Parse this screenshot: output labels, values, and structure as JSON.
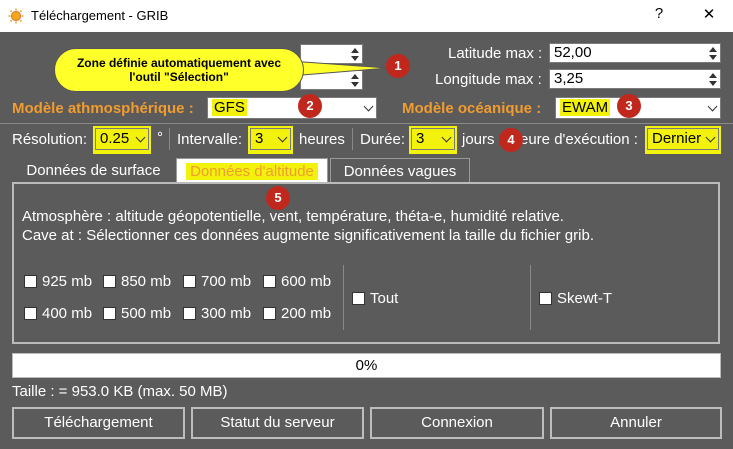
{
  "window": {
    "title": "Téléchargement - GRIB",
    "help": "?",
    "close": "✕"
  },
  "coords": {
    "latitude_max_label": "Latitude max :",
    "latitude_max_value": "52,00",
    "longitude_max_label": "Longitude max :",
    "longitude_max_value": "3,25"
  },
  "callout": {
    "text_line1": "Zone définie automatiquement avec",
    "text_line2": "l'outil \"Sélection\""
  },
  "models": {
    "atmo_label": "Modèle athmosphérique :",
    "atmo_value": "GFS",
    "ocean_label": "Modèle océanique :",
    "ocean_value": "EWAM"
  },
  "settings": {
    "resolution_label": "Résolution:",
    "resolution_value": "0.25",
    "resolution_unit": "°",
    "interval_label": "Intervalle:",
    "interval_value": "3",
    "interval_unit": "heures",
    "duration_label": "Durée:",
    "duration_value": "3",
    "duration_unit": "jours",
    "run_label": "eure d'exécution :",
    "run_value": "Dernier"
  },
  "badges": [
    "1",
    "2",
    "3",
    "4",
    "5"
  ],
  "tabs": [
    {
      "label": "Données de surface"
    },
    {
      "label": "Données d'altitude"
    },
    {
      "label": "Données vagues"
    }
  ],
  "panel": {
    "desc_line1": "Atmosphère : altitude géopotentielle, vent, température, théta-e, humidité relative.",
    "desc_line2": "Cave at : Sélectionner ces données augmente significativement la taille du fichier grib.",
    "levels_row1": [
      "925 mb",
      "850 mb",
      "700 mb",
      "600 mb"
    ],
    "levels_row2": [
      "400 mb",
      "500 mb",
      "300 mb",
      "200 mb"
    ],
    "all_label": "Tout",
    "skewt_label": "Skewt-T"
  },
  "progress": {
    "text": "0%",
    "value": 0
  },
  "size_text": "Taille : = 953.0 KB (max. 50 MB)",
  "buttons": {
    "download": "Téléchargement",
    "server_status": "Statut du serveur",
    "connect": "Connexion",
    "cancel": "Annuler"
  },
  "colors": {
    "accent_orange": "#f19c2f",
    "highlight_yellow": "#f2f20d",
    "badge_red": "#c0281e",
    "background": "#5b5b5b"
  }
}
